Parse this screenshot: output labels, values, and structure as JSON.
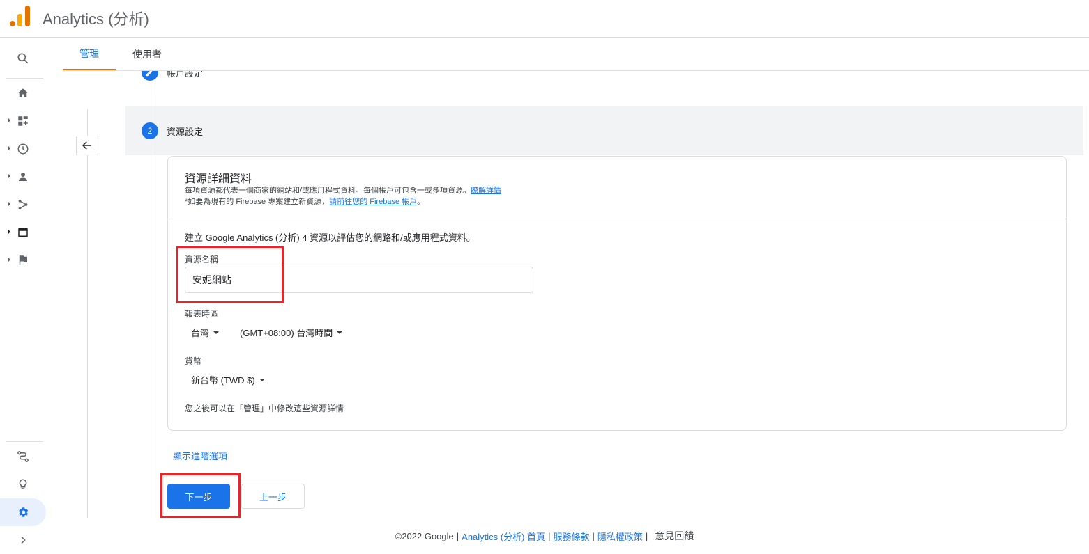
{
  "app": {
    "title": "Analytics (分析)"
  },
  "tabs": [
    {
      "label": "管理"
    },
    {
      "label": "使用者"
    }
  ],
  "rail": {
    "items": [
      {
        "icon": "search-icon"
      },
      {
        "icon": "home-icon"
      },
      {
        "icon": "dashboard-icon"
      },
      {
        "icon": "clock-icon"
      },
      {
        "icon": "person-icon"
      },
      {
        "icon": "share-icon"
      },
      {
        "icon": "display-icon"
      },
      {
        "icon": "flag-icon"
      },
      {
        "icon": "route-icon"
      },
      {
        "icon": "lightbulb-icon"
      },
      {
        "icon": "gear-icon"
      },
      {
        "icon": "chevron-right-icon"
      }
    ]
  },
  "stepper": {
    "step1_label": "帳戶設定",
    "step2_number": "2",
    "step2_label": "資源設定"
  },
  "card": {
    "title": "資源詳細資料",
    "desc_line1": "每項資源都代表一個商家的網站和/或應用程式資料。每個帳戶可包含一或多項資源。",
    "desc_link1": "瞭解詳情",
    "desc_line2": "*如要為現有的 Firebase 專案建立新資源，",
    "desc_link2": "請前往您的 Firebase 帳戶",
    "desc_line2_end": "。",
    "intro": "建立 Google Analytics (分析) 4 資源以評估您的網路和/或應用程式資料。",
    "name_label": "資源名稱",
    "name_value": "安妮網站",
    "timezone_label": "報表時區",
    "timezone_country": "台灣",
    "timezone_value": "(GMT+08:00) 台灣時間",
    "currency_label": "貨幣",
    "currency_value": "新台幣 (TWD $)",
    "note": "您之後可以在「管理」中修改這些資源詳情"
  },
  "advanced_link": "顯示進階選項",
  "buttons": {
    "next": "下一步",
    "prev": "上一步"
  },
  "footer": {
    "copyright": "©2022 Google",
    "home_link": "Analytics (分析) 首頁",
    "terms_link": "服務條款",
    "privacy_link": "隱私權政策",
    "feedback": "意見回饋"
  },
  "colors": {
    "accent": "#1a73e8",
    "tab_indicator": "#e37400",
    "highlight": "#e8232a"
  }
}
